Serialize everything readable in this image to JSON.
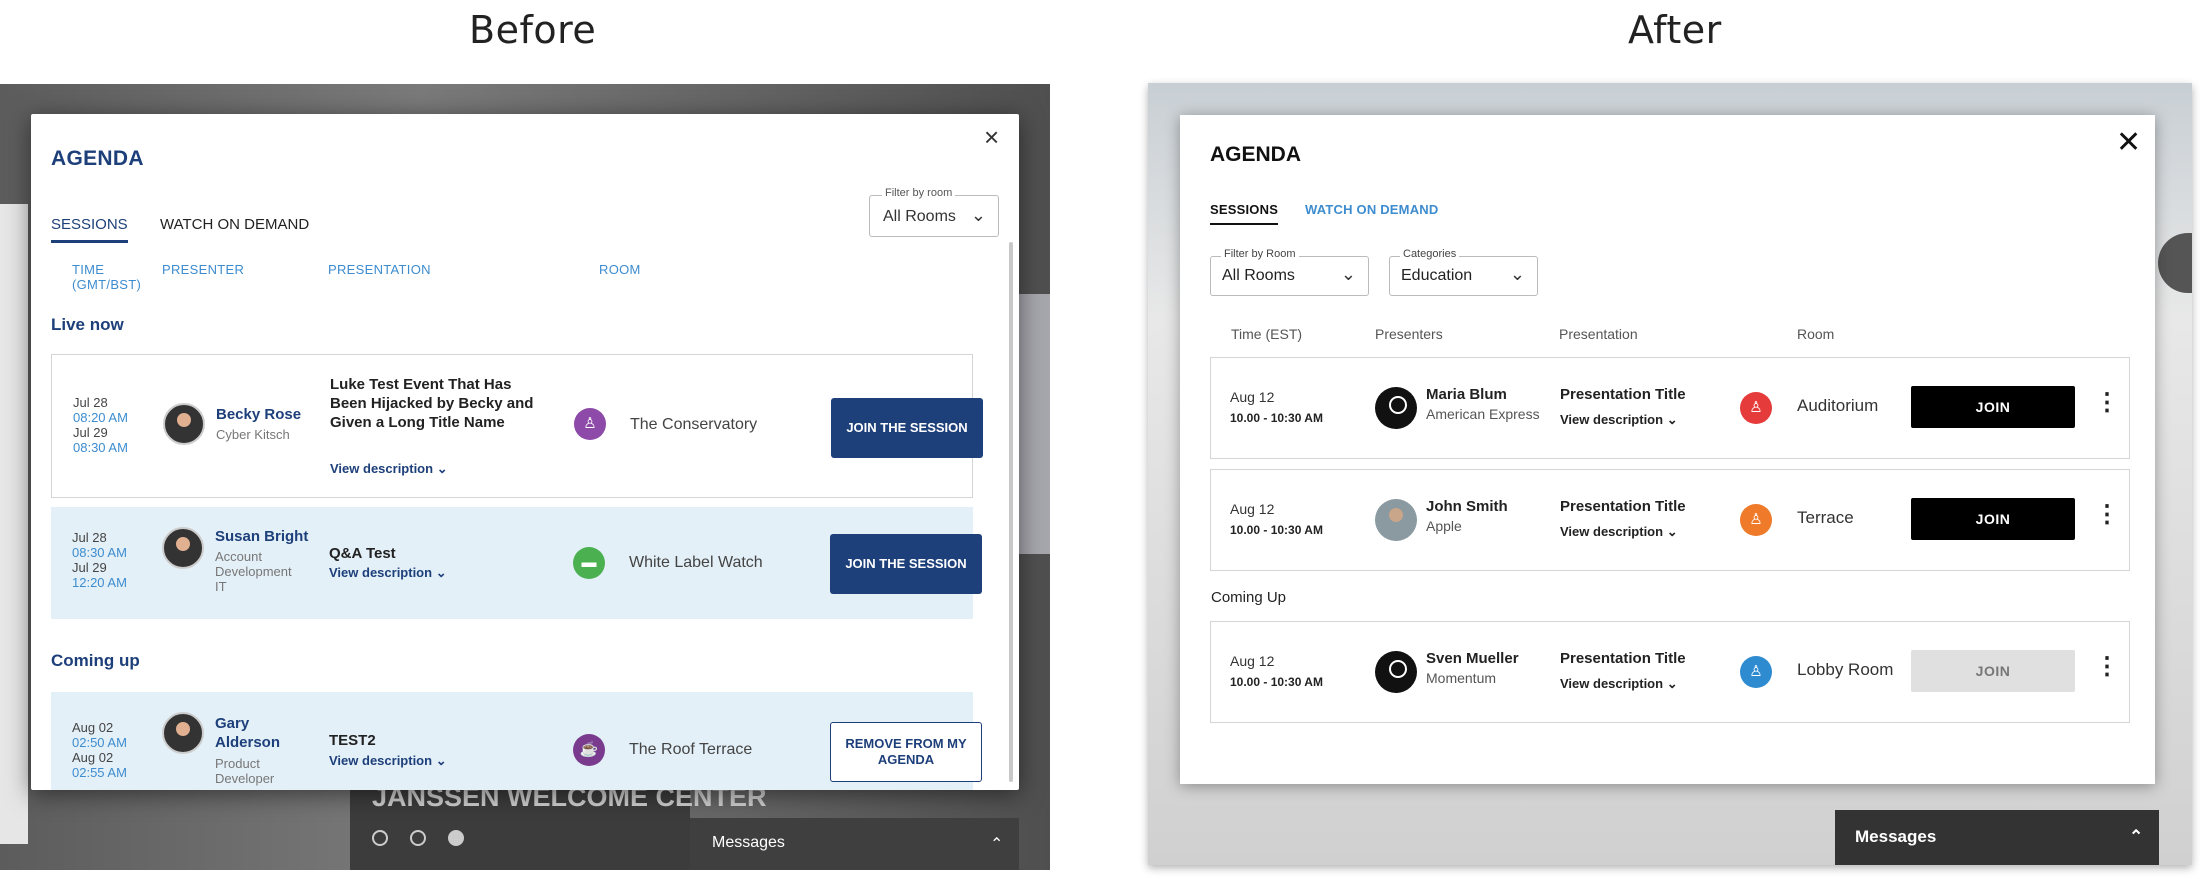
{
  "panels": {
    "before_title": "Before",
    "after_title": "After"
  },
  "before": {
    "agenda_title": "AGENDA",
    "close_glyph": "×",
    "tabs": [
      "SESSIONS",
      "WATCH ON DEMAND"
    ],
    "filter": {
      "label": "Filter by room",
      "value": "All Rooms"
    },
    "columns": {
      "time": "TIME",
      "time_zone": "(GMT/BST)",
      "presenter": "PRESENTER",
      "presentation": "PRESENTATION",
      "room": "ROOM"
    },
    "sections": {
      "live": "Live now",
      "upcoming": "Coming up"
    },
    "view_description": "View description",
    "sessions": [
      {
        "start_date": "Jul 28",
        "start_time": "08:20 AM",
        "end_date": "Jul 29",
        "end_time": "08:30 AM",
        "presenter": "Becky Rose",
        "org": "Cyber Kitsch",
        "title": "Luke Test Event That Has Been Hijacked by Becky and Given a Long Title Name",
        "room": "The Conservatory",
        "room_color": "#8d4aa8",
        "action": "JOIN THE SESSION"
      },
      {
        "start_date": "Jul 28",
        "start_time": "08:30 AM",
        "end_date": "Jul 29",
        "end_time": "12:20 AM",
        "presenter": "Susan Bright",
        "org": "Account Development IT",
        "title": "Q&A Test",
        "room": "White Label Watch",
        "room_color": "#4bb04f",
        "action": "JOIN THE SESSION"
      },
      {
        "start_date": "Aug 02",
        "start_time": "02:50 AM",
        "end_date": "Aug 02",
        "end_time": "02:55 AM",
        "presenter": "Gary Alderson",
        "org": "Product Developer",
        "title": "TEST2",
        "room": "The Roof Terrace",
        "room_color": "#7a3b8f",
        "action": "REMOVE FROM MY AGENDA"
      }
    ],
    "background_banner": "JANSSEN WELCOME CENTER",
    "messages": {
      "label": "Messages",
      "chevron": "⌃"
    }
  },
  "after": {
    "agenda_title": "AGENDA",
    "close_glyph": "✕",
    "tabs": [
      "SESSIONS",
      "WATCH ON DEMAND"
    ],
    "filters": [
      {
        "label": "Filter by Room",
        "value": "All Rooms"
      },
      {
        "label": "Categories",
        "value": "Education"
      }
    ],
    "columns": {
      "time": "Time (EST)",
      "presenters": "Presenters",
      "presentation": "Presentation",
      "room": "Room"
    },
    "section_upcoming": "Coming Up",
    "view_description": "View description",
    "sessions": [
      {
        "date": "Aug 12",
        "time": "10.00 - 10:30 AM",
        "presenter": "Maria Blum",
        "org": "American Express",
        "title": "Presentation Title",
        "room": "Auditorium",
        "room_color": "#e63b3b",
        "action": "JOIN",
        "enabled": true
      },
      {
        "date": "Aug 12",
        "time": "10.00 - 10:30 AM",
        "presenter": "John Smith",
        "org": "Apple",
        "title": "Presentation Title",
        "room": "Terrace",
        "room_color": "#ee7a2a",
        "action": "JOIN",
        "enabled": true
      },
      {
        "date": "Aug 12",
        "time": "10.00 - 10:30 AM",
        "presenter": "Sven Mueller",
        "org": "Momentum",
        "title": "Presentation Title",
        "room": "Lobby Room",
        "room_color": "#2f8bd0",
        "action": "JOIN",
        "enabled": false
      }
    ],
    "messages": {
      "label": "Messages",
      "chevron": "⌃"
    }
  },
  "colors": {
    "before_accent": "#1d3f7a",
    "before_link": "#3d8ccf",
    "after_accent": "#000000",
    "after_link": "#3d8ccf"
  }
}
